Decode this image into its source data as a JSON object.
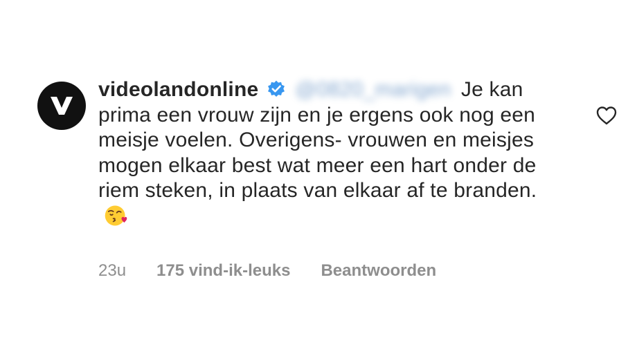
{
  "comment": {
    "username": "videolandonline",
    "verified": true,
    "mention": "@0820_marigen",
    "text": "Je kan prima een vrouw zijn en je ergens ook nog een meisje voelen. Overigens- vrouwen en meisjes mogen elkaar best wat meer een hart onder de riem steken, in plaats van elkaar af te branden.",
    "emoji": "kissing-heart-face",
    "time": "23u",
    "likes": "175 vind-ik-leuks",
    "reply": "Beantwoorden",
    "colors": {
      "text": "#262626",
      "meta": "#8e8e8e",
      "verified": "#3897f0",
      "avatar": "#111111"
    }
  }
}
